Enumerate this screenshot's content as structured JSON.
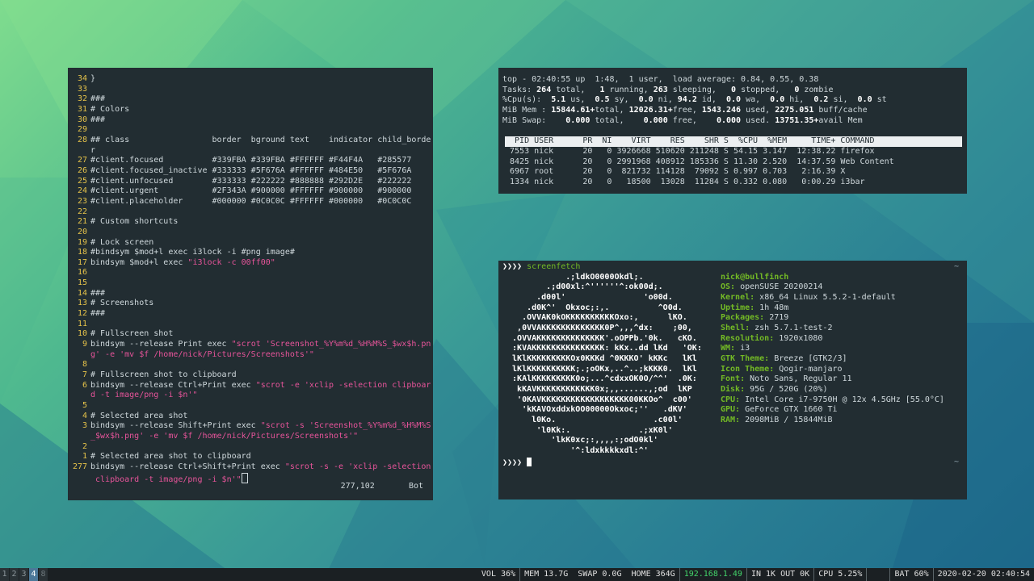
{
  "colors": {
    "terminal_bg": "#222d32",
    "line_number": "#e6c34a",
    "string": "#e7549a",
    "accent_green": "#73ba25",
    "ip_green": "#43d46a",
    "bar_bg": "#1b2023",
    "active_ws": "#4c7899"
  },
  "editor": {
    "lines": [
      {
        "n": "34",
        "t": "}"
      },
      {
        "n": "33",
        "t": ""
      },
      {
        "n": "32",
        "t": "###"
      },
      {
        "n": "31",
        "t": "# Colors"
      },
      {
        "n": "30",
        "t": "###"
      },
      {
        "n": "29",
        "t": ""
      },
      {
        "n": "28",
        "t": "## class                 border  bground text    indicator child_borde"
      },
      {
        "n": "",
        "t": "r"
      },
      {
        "n": "27",
        "t": "#client.focused          #339FBA #339FBA #FFFFFF #F44F4A   #285577"
      },
      {
        "n": "26",
        "t": "#client.focused_inactive #333333 #5F676A #FFFFFF #484E50   #5F676A"
      },
      {
        "n": "25",
        "t": "#client.unfocused        #333333 #222222 #888888 #292D2E   #222222"
      },
      {
        "n": "24",
        "t": "#client.urgent           #2F343A #900000 #FFFFFF #900000   #900000"
      },
      {
        "n": "23",
        "t": "#client.placeholder      #000000 #0C0C0C #FFFFFF #000000   #0C0C0C"
      },
      {
        "n": "22",
        "t": ""
      },
      {
        "n": "21",
        "t": "# Custom shortcuts"
      },
      {
        "n": "20",
        "t": ""
      },
      {
        "n": "19",
        "t": "# Lock screen"
      },
      {
        "n": "18",
        "t": "#bindsym $mod+l exec i3lock -i #png image#"
      },
      {
        "n": "17",
        "t": "bindsym $mod+l exec ",
        "s": "\"i3lock -c 00ff00\""
      },
      {
        "n": "16",
        "t": ""
      },
      {
        "n": "15",
        "t": ""
      },
      {
        "n": "14",
        "t": "###"
      },
      {
        "n": "13",
        "t": "# Screenshots"
      },
      {
        "n": "12",
        "t": "###"
      },
      {
        "n": "11",
        "t": ""
      },
      {
        "n": "10",
        "t": "# Fullscreen shot"
      },
      {
        "n": "9",
        "t": "bindsym --release Print exec ",
        "s": "\"scrot 'Screenshot_%Y%m%d_%H%M%S_$wx$h.pn"
      },
      {
        "n": "",
        "t": "",
        "s": "g' -e 'mv $f /home/nick/Pictures/Screenshots'\""
      },
      {
        "n": "8",
        "t": ""
      },
      {
        "n": "7",
        "t": "# Fullscreen shot to clipboard"
      },
      {
        "n": "6",
        "t": "bindsym --release Ctrl+Print exec ",
        "s": "\"scrot -e 'xclip -selection clipboar"
      },
      {
        "n": "",
        "t": "",
        "s": "d -t image/png -i $n'\""
      },
      {
        "n": "5",
        "t": ""
      },
      {
        "n": "4",
        "t": "# Selected area shot"
      },
      {
        "n": "3",
        "t": "bindsym --release Shift+Print exec ",
        "s": "\"scrot -s 'Screenshot_%Y%m%d_%H%M%S"
      },
      {
        "n": "",
        "t": "",
        "s": "_$wx$h.png' -e 'mv $f /home/nick/Pictures/Screenshots'\""
      },
      {
        "n": "2",
        "t": ""
      },
      {
        "n": "1",
        "t": "# Selected area shot to clipboard"
      },
      {
        "n": "277",
        "t": "bindsym --release Ctrl+Shift+Print exec ",
        "s": "\"scrot -s -e 'xclip -selection"
      },
      {
        "n": "",
        "t": "",
        "s": " clipboard -t image/png -i $n'\"",
        "cursor": true
      }
    ],
    "ruler_pos": "277,102",
    "ruler_where": "Bot"
  },
  "top": {
    "line1": "top - 02:40:55 up  1:48,  1 user,  load average: 0.84, 0.55, 0.38",
    "tasks": [
      "Tasks: ",
      "264",
      " total,   ",
      "1",
      " running, ",
      "263",
      " sleeping,   ",
      "0",
      " stopped,   ",
      "0",
      " zombie"
    ],
    "cpu": [
      "%Cpu(s):  ",
      "5.1",
      " us,  ",
      "0.5",
      " sy,  ",
      "0.0",
      " ni, ",
      "94.2",
      " id,  ",
      "0.0",
      " wa,  ",
      "0.0",
      " hi,  ",
      "0.2",
      " si,  ",
      "0.0",
      " st"
    ],
    "mem": [
      "MiB Mem : ",
      "15844.61+",
      "total, ",
      "12026.31+",
      "free, ",
      "1543.246",
      " used, ",
      "2275.051",
      " buff/cache"
    ],
    "swap": [
      "MiB Swap:    ",
      "0.000",
      " total,    ",
      "0.000",
      " free,    ",
      "0.000",
      " used. ",
      "13751.35+",
      "avail Mem"
    ],
    "header": "  PID USER      PR  NI    VIRT    RES    SHR S  %CPU  %MEM     TIME+ COMMAND",
    "rows": [
      " 7553 nick      20   0 3926668 510620 211248 S 54.15 3.147  12:38.22 firefox",
      " 8425 nick      20   0 2991968 408912 185336 S 11.30 2.520  14:37.59 Web Content",
      " 6967 root      20   0  821732 114128  79092 S 0.997 0.703   2:16.39 X",
      " 1334 nick      20   0   18500  13028  11284 S 0.332 0.080   0:00.29 i3bar"
    ]
  },
  "screenfetch": {
    "prompt": "❯❯❯❯",
    "command": "screenfetch",
    "tilde": "~",
    "logo": [
      "             .;ldkO0000Okdl;.",
      "         .;d00xl:^''''''^:ok00d;.",
      "       .d00l'                'o00d.",
      "     .d0K^'  Okxoc;:,.          ^O0d.",
      "    .OVVAK0kOKKKKKKKKKKOxo:,      lKO.",
      "   ,0VVAKKKKKKKKKKKKK0P^,,,^dx:    ;00,",
      "  .OVVAKKKKKKKKKKKKKK'.oOPPb.'0k.   cKO.",
      "  :KVAKKKKKKKKKKKKKKK: kKx..dd lKd   'OK:",
      "  lKlKKKKKKKKKOx0KKKd ^0KKKO' kKKc   lKl",
      "  lKlKKKKKKKKKK;.;oOKx,..^..;kKKK0.  lKl",
      "  :KAlKKKKKKKKK0o;...^cdxxOK0O/^^'  .0K:",
      "   kKAVKKKKKKKKKKKK0x;,,......,;od  lKP",
      "   '0KAVKKKKKKKKKKKKKKKKKK00KKOo^  c00'",
      "    'kKAVOxddxkOO00000Okxoc;''   .dKV'",
      "      l0Ko.                    .c00l'",
      "       'l0Kk:.              .;xK0l'",
      "          'lkK0xc;:,,,,:;odO0kl'",
      "              '^:ldxkkkkxdl:^'"
    ],
    "info": [
      {
        "k": "nick@bullfinch",
        "v": ""
      },
      {
        "k": "OS:",
        "v": " openSUSE 20200214"
      },
      {
        "k": "Kernel:",
        "v": " x86_64 Linux 5.5.2-1-default"
      },
      {
        "k": "Uptime:",
        "v": " 1h 48m"
      },
      {
        "k": "Packages:",
        "v": " 2719"
      },
      {
        "k": "Shell:",
        "v": " zsh 5.7.1-test-2"
      },
      {
        "k": "Resolution:",
        "v": " 1920x1080"
      },
      {
        "k": "WM:",
        "v": " i3"
      },
      {
        "k": "GTK Theme:",
        "v": " Breeze [GTK2/3]"
      },
      {
        "k": "Icon Theme:",
        "v": " Qogir-manjaro"
      },
      {
        "k": "Font:",
        "v": " Noto Sans, Regular 11"
      },
      {
        "k": "Disk:",
        "v": " 95G / 520G (20%)"
      },
      {
        "k": "CPU:",
        "v": " Intel Core i7-9750H @ 12x 4.5GHz [55.0°C]"
      },
      {
        "k": "GPU:",
        "v": " GeForce GTX 1660 Ti"
      },
      {
        "k": "RAM:",
        "v": " 2098MiB / 15844MiB"
      }
    ]
  },
  "bar": {
    "workspaces": [
      {
        "n": "1",
        "active": false
      },
      {
        "n": "2",
        "active": false
      },
      {
        "n": "3",
        "active": false
      },
      {
        "n": "4",
        "active": true
      },
      {
        "n": "8",
        "active": false,
        "dim": true
      }
    ],
    "status": [
      {
        "t": "VOL 36%",
        "c": ""
      },
      {
        "t": "MEM 13.7G  SWAP 0.0G  HOME 364G",
        "c": ""
      },
      {
        "t": "192.168.1.49",
        "c": "green"
      },
      {
        "t": "IN 1K OUT 0K",
        "c": ""
      },
      {
        "t": "CPU 5.25%",
        "c": ""
      },
      {
        "t": "   ",
        "c": ""
      },
      {
        "t": "BAT 60%",
        "c": ""
      },
      {
        "t": "2020-02-20 02:40:54",
        "c": ""
      }
    ]
  }
}
